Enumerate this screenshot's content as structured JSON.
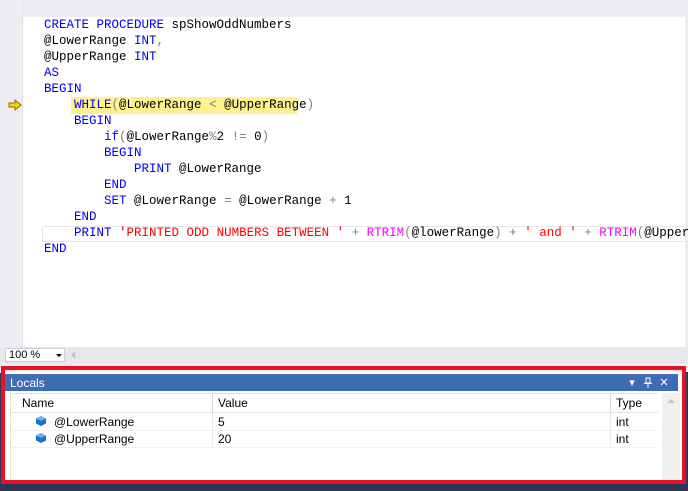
{
  "editor": {
    "lines": [
      [
        {
          "t": "CREATE PROCEDURE",
          "c": "k"
        },
        {
          "t": " spShowOddNumbers",
          "c": "i"
        }
      ],
      [
        {
          "t": "@LowerRange ",
          "c": "i"
        },
        {
          "t": "INT",
          "c": "k"
        },
        {
          "t": ",",
          "c": "g"
        }
      ],
      [
        {
          "t": "@UpperRange ",
          "c": "i"
        },
        {
          "t": "INT",
          "c": "k"
        }
      ],
      [
        {
          "t": "AS",
          "c": "k"
        }
      ],
      [
        {
          "t": "BEGIN",
          "c": "k"
        }
      ],
      [
        {
          "t": "    ",
          "c": "i"
        },
        {
          "t": "WHILE",
          "c": "k"
        },
        {
          "t": "(",
          "c": "g"
        },
        {
          "t": "@LowerRange ",
          "c": "i"
        },
        {
          "t": "<",
          "c": "g"
        },
        {
          "t": " @UpperRange",
          "c": "i"
        },
        {
          "t": ")",
          "c": "g"
        }
      ],
      [
        {
          "t": "    ",
          "c": "i"
        },
        {
          "t": "BEGIN",
          "c": "k"
        }
      ],
      [
        {
          "t": "        ",
          "c": "i"
        },
        {
          "t": "if",
          "c": "k"
        },
        {
          "t": "(",
          "c": "g"
        },
        {
          "t": "@LowerRange",
          "c": "i"
        },
        {
          "t": "%",
          "c": "g"
        },
        {
          "t": "2 ",
          "c": "i"
        },
        {
          "t": "!=",
          "c": "g"
        },
        {
          "t": " 0",
          "c": "i"
        },
        {
          "t": ")",
          "c": "g"
        }
      ],
      [
        {
          "t": "        ",
          "c": "i"
        },
        {
          "t": "BEGIN",
          "c": "k"
        }
      ],
      [
        {
          "t": "            ",
          "c": "i"
        },
        {
          "t": "PRINT",
          "c": "k"
        },
        {
          "t": " @LowerRange",
          "c": "i"
        }
      ],
      [
        {
          "t": "        ",
          "c": "i"
        },
        {
          "t": "END",
          "c": "k"
        }
      ],
      [
        {
          "t": "        ",
          "c": "i"
        },
        {
          "t": "SET",
          "c": "k"
        },
        {
          "t": " @LowerRange ",
          "c": "i"
        },
        {
          "t": "=",
          "c": "g"
        },
        {
          "t": " @LowerRange ",
          "c": "i"
        },
        {
          "t": "+",
          "c": "g"
        },
        {
          "t": " 1",
          "c": "i"
        }
      ],
      [
        {
          "t": "    ",
          "c": "i"
        },
        {
          "t": "END",
          "c": "k"
        }
      ],
      [
        {
          "t": "    ",
          "c": "i"
        },
        {
          "t": "PRINT",
          "c": "k"
        },
        {
          "t": " ",
          "c": "i"
        },
        {
          "t": "'PRINTED ODD NUMBERS BETWEEN '",
          "c": "s"
        },
        {
          "t": " + ",
          "c": "g"
        },
        {
          "t": "RTRIM",
          "c": "f"
        },
        {
          "t": "(",
          "c": "g"
        },
        {
          "t": "@lowerRange",
          "c": "i"
        },
        {
          "t": ")",
          "c": "g"
        },
        {
          "t": " + ",
          "c": "g"
        },
        {
          "t": "' and '",
          "c": "s"
        },
        {
          "t": " + ",
          "c": "g"
        },
        {
          "t": "RTRIM",
          "c": "f"
        },
        {
          "t": "(",
          "c": "g"
        },
        {
          "t": "@UpperRange",
          "c": "i"
        },
        {
          "t": ")",
          "c": "g"
        }
      ],
      [
        {
          "t": "END",
          "c": "k"
        }
      ]
    ]
  },
  "zoom": {
    "value": "100 %"
  },
  "locals": {
    "title": "Locals",
    "columns": {
      "name": "Name",
      "value": "Value",
      "type": "Type"
    },
    "rows": [
      {
        "name": "@LowerRange",
        "value": "5",
        "type": "int"
      },
      {
        "name": "@UpperRange",
        "value": "20",
        "type": "int"
      }
    ]
  },
  "colors": {
    "keyword": "#0000ff",
    "operator": "#808080",
    "string": "#ff0000",
    "function": "#ff00ff",
    "highlight": "#fff28e",
    "panel_header": "#3e6db5",
    "annotation": "#e81123"
  }
}
